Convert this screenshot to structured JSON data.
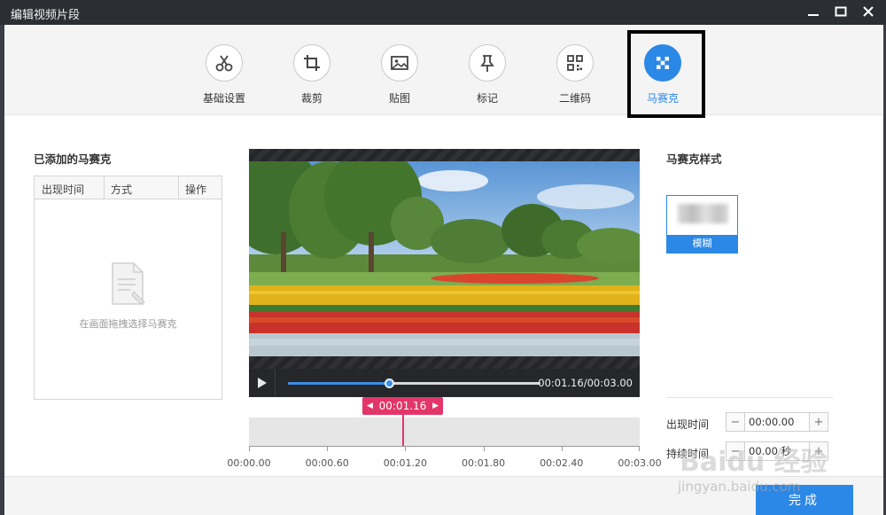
{
  "window": {
    "title": "编辑视频片段"
  },
  "toolbar": {
    "tools": [
      {
        "label": "基础设置",
        "icon": "scissors-icon"
      },
      {
        "label": "裁剪",
        "icon": "crop-icon"
      },
      {
        "label": "贴图",
        "icon": "image-icon"
      },
      {
        "label": "标记",
        "icon": "pin-icon"
      },
      {
        "label": "二维码",
        "icon": "qrcode-icon"
      },
      {
        "label": "马赛克",
        "icon": "mosaic-icon",
        "active": true
      }
    ]
  },
  "mosaic_list": {
    "title": "已添加的马赛克",
    "columns": [
      "出现时间",
      "方式",
      "操作"
    ],
    "empty_text": "在画面拖拽选择马赛克"
  },
  "player": {
    "time_readout": "00:01.16/00:03.00",
    "progress": 0.4
  },
  "timeline": {
    "marker_time": "00:01.16",
    "ticks": [
      "00:00.00",
      "00:00.60",
      "00:01.20",
      "00:01.80",
      "00:02.40",
      "00:03.00"
    ]
  },
  "mosaic_style": {
    "title": "马赛克样式",
    "option_label": "模糊"
  },
  "timing": {
    "appear_label": "出现时间",
    "appear_value": "00:00.00",
    "duration_label": "持续时间",
    "duration_value": "00.00 秒"
  },
  "footer": {
    "done_label": "完成"
  },
  "watermark": {
    "brand": "Baidu 经验",
    "url": "jingyan.baidu.com"
  },
  "colors": {
    "accent": "#2c88e6",
    "marker": "#e2366a",
    "titlebar": "#2b2e33"
  }
}
